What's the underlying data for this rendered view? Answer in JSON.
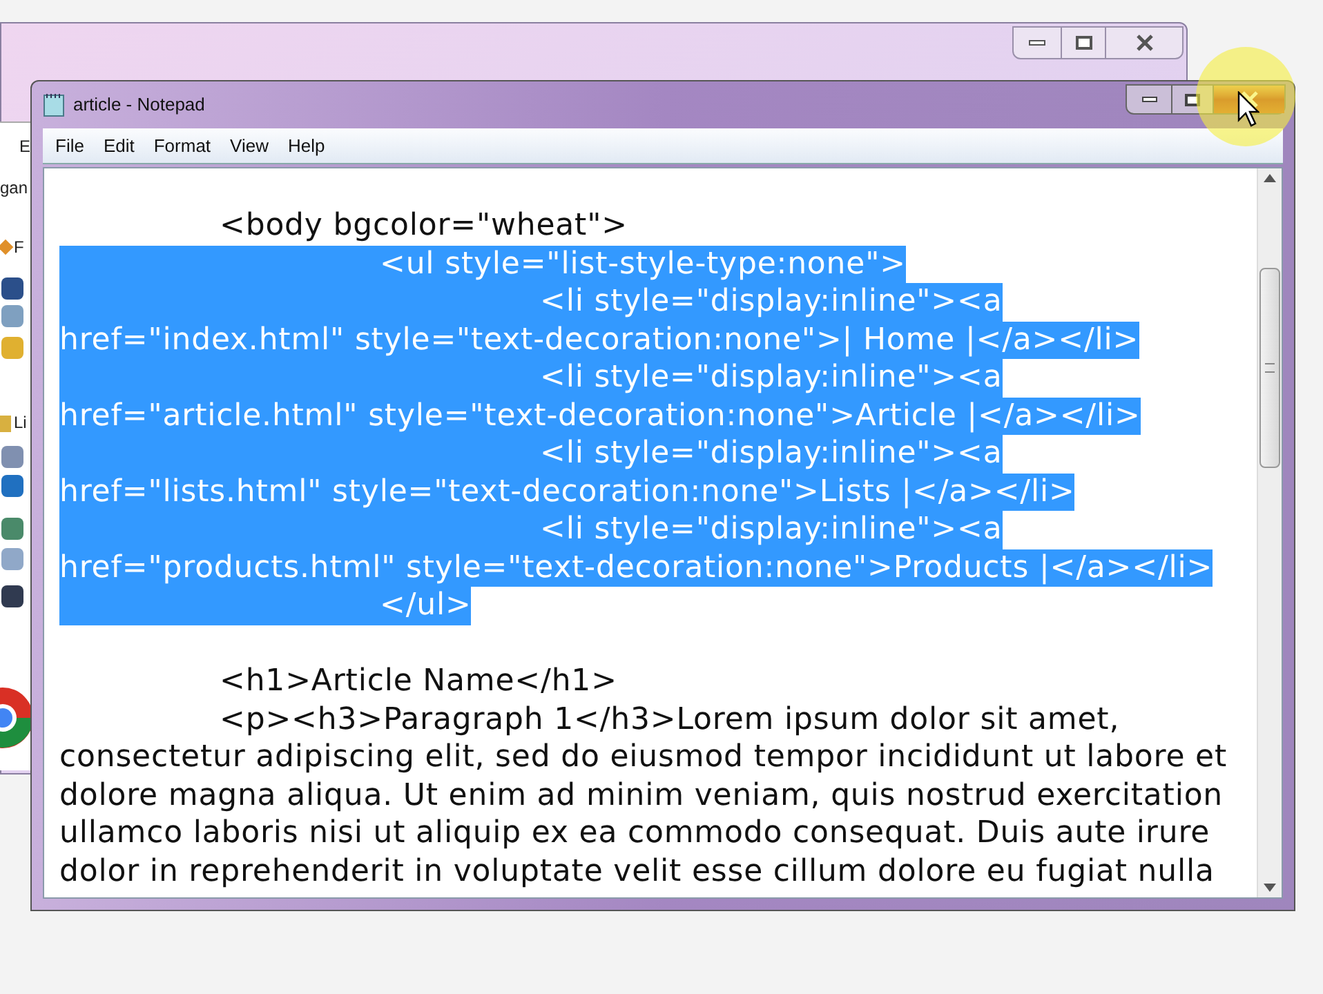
{
  "back_window": {
    "fragments": [
      "E",
      "gan",
      "F",
      "Li"
    ]
  },
  "window": {
    "title": "article - Notepad",
    "close_hovered": true
  },
  "menu": [
    {
      "label": "File"
    },
    {
      "label": "Edit"
    },
    {
      "label": "Format"
    },
    {
      "label": "View"
    },
    {
      "label": "Help"
    }
  ],
  "lines": [
    {
      "kind": "text",
      "text": "\t<body bgcolor=\"wheat\">",
      "selected": false
    },
    {
      "kind": "text",
      "text": "\t\t<ul style=\"list-style-type:none\">",
      "selected": true
    },
    {
      "kind": "text",
      "text": "\t\t\t<li style=\"display:inline\"><a",
      "selected": true
    },
    {
      "kind": "text",
      "text": "href=\"index.html\" style=\"text-decoration:none\">| Home |</a></li>",
      "selected": true
    },
    {
      "kind": "text",
      "text": "\t\t\t<li style=\"display:inline\"><a",
      "selected": true
    },
    {
      "kind": "text",
      "text": "href=\"article.html\" style=\"text-decoration:none\">Article |</a></li>",
      "selected": true
    },
    {
      "kind": "text",
      "text": "\t\t\t<li style=\"display:inline\"><a",
      "selected": true
    },
    {
      "kind": "text",
      "text": "href=\"lists.html\" style=\"text-decoration:none\">Lists |</a></li>",
      "selected": true
    },
    {
      "kind": "text",
      "text": "\t\t\t<li style=\"display:inline\"><a",
      "selected": true
    },
    {
      "kind": "text",
      "text": "href=\"products.html\" style=\"text-decoration:none\">Products |</a></li>",
      "selected": true
    },
    {
      "kind": "text",
      "text": "\t\t</ul>",
      "selected": true
    },
    {
      "kind": "blank"
    },
    {
      "kind": "text",
      "text": "\t<h1>Article Name</h1>",
      "selected": false
    },
    {
      "kind": "text",
      "text": "\t<p><h3>Paragraph 1</h3>Lorem ipsum dolor sit amet,",
      "selected": false
    },
    {
      "kind": "text",
      "text": "consectetur adipiscing elit, sed do eiusmod tempor incididunt ut labore et",
      "selected": false
    },
    {
      "kind": "text",
      "text": "dolore magna aliqua. Ut enim ad minim veniam, quis nostrud exercitation",
      "selected": false
    },
    {
      "kind": "text",
      "text": "ullamco laboris nisi ut aliquip ex ea commodo consequat. Duis aute irure",
      "selected": false
    },
    {
      "kind": "text",
      "text": "dolor in reprehenderit in voluptate velit esse cillum dolore eu fugiat nulla",
      "selected": false
    }
  ]
}
